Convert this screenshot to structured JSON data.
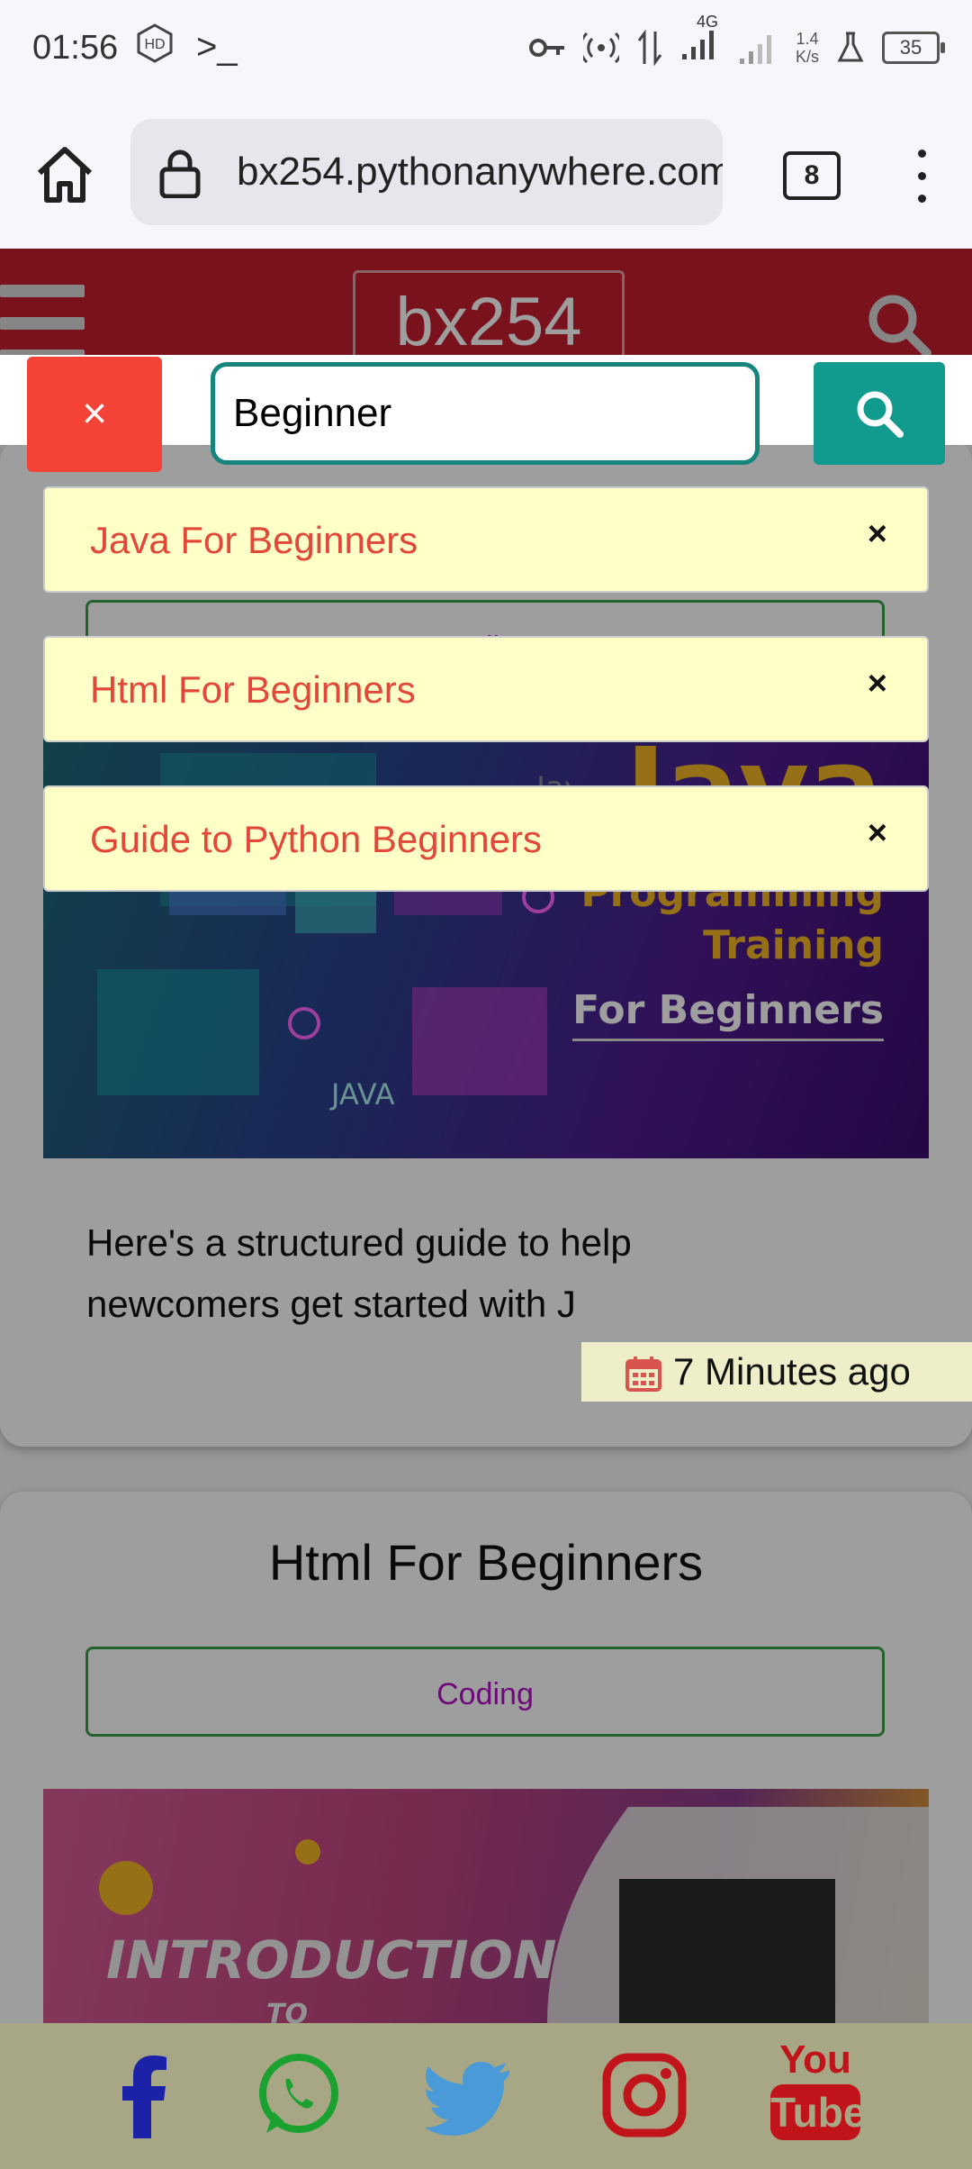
{
  "status_bar": {
    "time": "01:56",
    "icons": [
      "hd-icon",
      "terminal-icon",
      "key-icon",
      "hotspot-icon",
      "data-arrows-icon",
      "signal-icon",
      "signal-icon",
      "flask-icon"
    ],
    "network": "4G",
    "speed_value": "1.4",
    "speed_unit": "K/s",
    "battery": "35"
  },
  "browser": {
    "url": "bx254.pythonanywhere.com",
    "tab_count": "8"
  },
  "site": {
    "logo": "bx254"
  },
  "search": {
    "close_label": "×",
    "query": "Beginner",
    "suggestions": [
      {
        "label": "Java For Beginners",
        "close": "×"
      },
      {
        "label": "Html For Beginners",
        "close": "×"
      },
      {
        "label": "Guide to Python Beginners",
        "close": "×"
      }
    ]
  },
  "posts": [
    {
      "tag": "Coding",
      "banner": {
        "big": "Java",
        "line1": "Programming",
        "line2": "Training",
        "line3": "For Beginners",
        "label_java": "JAVA",
        "label_java2": "Java"
      },
      "excerpt": "Here's a structured guide to help newcomers get started with J",
      "time": "7 Minutes ago"
    },
    {
      "title": "Html For Beginners",
      "tag": "Coding",
      "banner": {
        "line1": "INTRODUCTION",
        "line2": "TO"
      }
    }
  ],
  "footer": {
    "social": [
      "facebook",
      "whatsapp",
      "twitter",
      "instagram",
      "youtube"
    ],
    "youtube_top": "You",
    "youtube_bottom": "Tube"
  },
  "colors": {
    "header_red": "#c41e2f",
    "close_red": "#f44336",
    "teal": "#119b8e",
    "suggestion_bg": "#ffffc8",
    "suggestion_text": "#e2473a",
    "footer_bg": "#a7a786"
  }
}
